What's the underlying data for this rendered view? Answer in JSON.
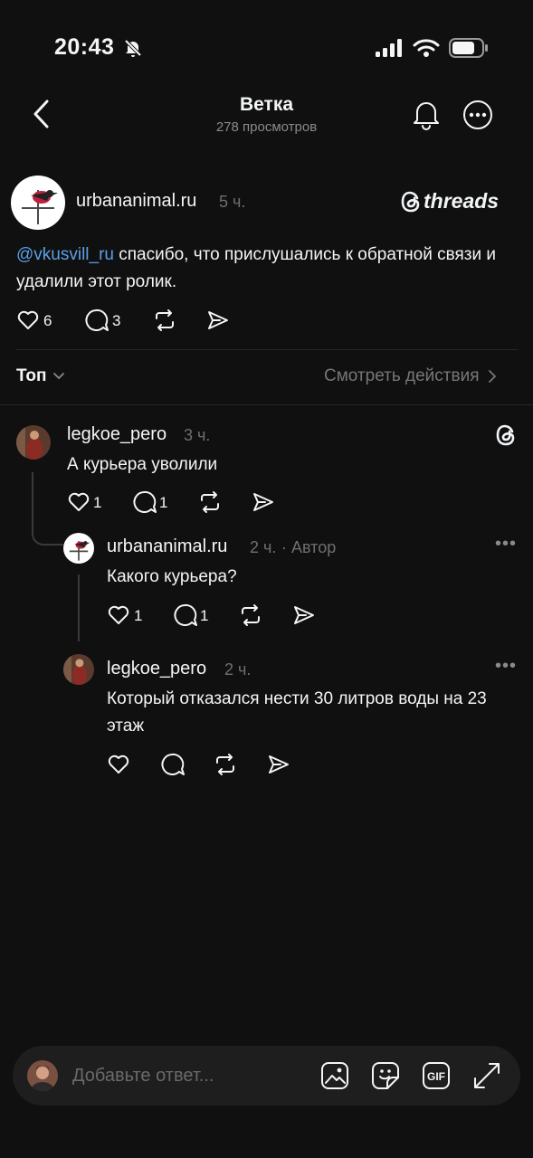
{
  "status_bar": {
    "time": "20:43"
  },
  "header": {
    "title": "Ветка",
    "views": "278 просмотров"
  },
  "main_post": {
    "username": "urbananimal.ru",
    "time": "5 ч.",
    "threads_logo_text": "threads",
    "mention": "@vkusvill_ru",
    "text": " спасибо, что прислушались к обратной связи и удалили этот ролик.",
    "likes": "6",
    "replies": "3"
  },
  "sort_bar": {
    "sort_label": "Топ",
    "activity_link": "Смотреть действия"
  },
  "replies": [
    {
      "username": "legkoe_pero",
      "time": "3 ч.",
      "text": "А курьера уволили",
      "likes": "1",
      "replies": "1"
    },
    {
      "username": "urbananimal.ru",
      "time": "2 ч.",
      "author_tag": "· Автор",
      "text": "Какого курьера?",
      "likes": "1",
      "replies": "1"
    },
    {
      "username": "legkoe_pero",
      "time": "2 ч.",
      "text": "Который отказался нести 30 литров воды на 23 этаж",
      "likes": "",
      "replies": ""
    }
  ],
  "composer": {
    "placeholder": "Добавьте ответ..."
  },
  "colors": {
    "background": "#101010",
    "text": "#f3f5f7",
    "muted": "#777777",
    "mention": "#5aa0e6"
  }
}
